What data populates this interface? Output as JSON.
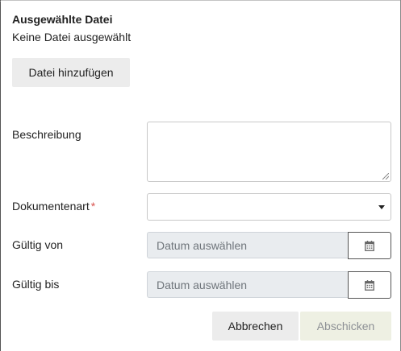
{
  "file_section": {
    "title": "Ausgewählte Datei",
    "value": "Keine Datei ausgewählt",
    "add_button": "Datei hinzufügen"
  },
  "form": {
    "description_label": "Beschreibung",
    "description_value": "",
    "doctype_label": "Dokumentenart",
    "doctype_required_mark": "*",
    "doctype_selected": "",
    "valid_from_label": "Gültig von",
    "valid_from_placeholder": "Datum auswählen",
    "valid_to_label": "Gültig bis",
    "valid_to_placeholder": "Datum auswählen"
  },
  "actions": {
    "cancel": "Abbrechen",
    "submit": "Abschicken"
  },
  "icons": {
    "calendar": "calendar-icon",
    "dropdown": "chevron-down-icon",
    "resize": "resize-grip-icon"
  },
  "colors": {
    "required": "#d9534f",
    "disabled_input_bg": "#e9ecef",
    "submit_disabled_bg": "#eef0e3"
  }
}
